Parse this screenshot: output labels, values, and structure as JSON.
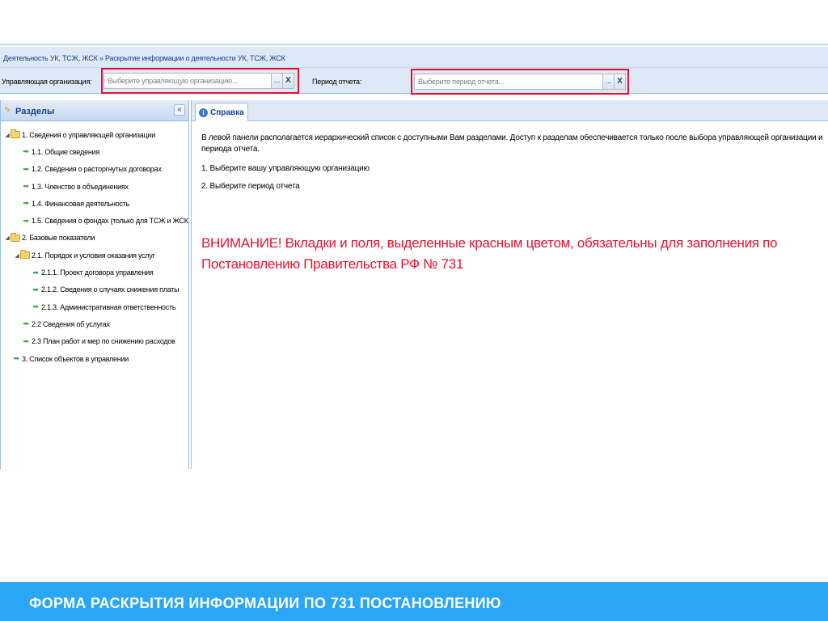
{
  "breadcrumb": "Деятельность УК, ТСЖ, ЖСК » Раскрытие информации о деятельности УК, ТСЖ, ЖСК",
  "filters": {
    "org_label": "Управляющая организация:",
    "org_placeholder": "Выберите управляющую организацию...",
    "period_label": "Период отчета:",
    "period_placeholder": "Выберите период отчета...",
    "picker_glyph": "...",
    "clear_glyph": "X"
  },
  "sidebar": {
    "title": "Разделы",
    "collapse_glyph": "«",
    "items": [
      {
        "label": "1. Сведения о управляющей организации",
        "level": 0,
        "type": "folder"
      },
      {
        "label": "1.1. Общие сведения",
        "level": 1,
        "type": "leaf"
      },
      {
        "label": "1.2. Сведения о расторгнутых договорах",
        "level": 1,
        "type": "leaf"
      },
      {
        "label": "1.3. Членство в объединениях",
        "level": 1,
        "type": "leaf"
      },
      {
        "label": "1.4. Финансовая деятельность",
        "level": 1,
        "type": "leaf"
      },
      {
        "label": "1.5. Сведения о фондах (только для ТСЖ и ЖСК",
        "level": 1,
        "type": "leaf"
      },
      {
        "label": "2. Базовые показатели",
        "level": 0,
        "type": "folder"
      },
      {
        "label": "2.1. Порядок и условия оказания услуг",
        "level": 1,
        "type": "folder"
      },
      {
        "label": "2.1.1. Проект договора управления",
        "level": 2,
        "type": "leaf"
      },
      {
        "label": "2.1.2. Сведения о случаях снижения платы",
        "level": 2,
        "type": "leaf"
      },
      {
        "label": "2.1.3. Административная ответственность",
        "level": 2,
        "type": "leaf"
      },
      {
        "label": "2.2 Сведения об услугах",
        "level": 1,
        "type": "leaf"
      },
      {
        "label": "2.3 План работ и мер по снижению расходов",
        "level": 1,
        "type": "leaf"
      },
      {
        "label": "3. Список объектов в управлении",
        "level": 0,
        "type": "leaf"
      }
    ]
  },
  "tab": {
    "label": "Справка",
    "icon": "info-icon"
  },
  "help": {
    "intro": "В левой панели располагается иерархический список с доступными Вам разделами. Доступ к разделам обеспечивается только после выбора управляющей организации и периода отчета.",
    "step1": "1. Выберите вашу управляющую организацию",
    "step2": "2. Выберите период отчета",
    "warning": "ВНИМАНИЕ! Вкладки и поля, выделенные красным цветом, обязательны для заполнения по Постановлению Правительства РФ № 731"
  },
  "footer": {
    "title": "ФОРМА РАСКРЫТИЯ ИНФОРМАЦИИ ПО 731 ПОСТАНОВЛЕНИЮ"
  },
  "colors": {
    "accent_red": "#e8112d",
    "footer_blue": "#2ba6f4",
    "header_blue": "#15428b",
    "panel_bg": "#dfe8f6"
  }
}
